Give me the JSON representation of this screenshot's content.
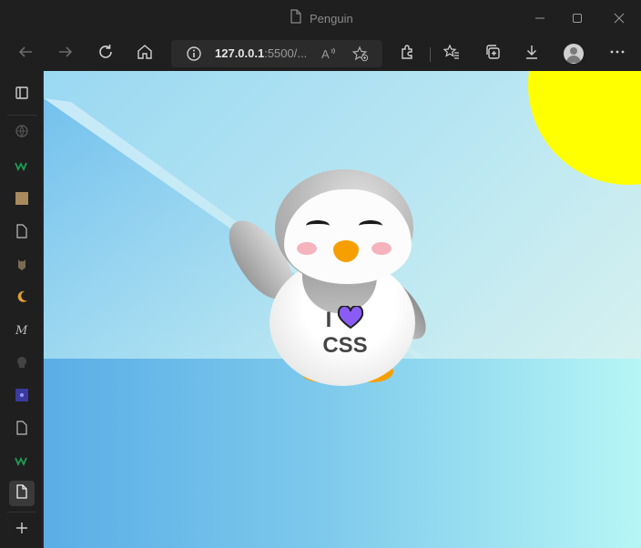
{
  "window": {
    "title": "Penguin",
    "controls": [
      "minimize-icon",
      "maximize-icon",
      "close-icon"
    ]
  },
  "toolbar": {
    "buttons": [
      "back-icon",
      "forward-icon",
      "refresh-icon",
      "home-icon"
    ],
    "address": {
      "host": "127.0.0.1",
      "rest": ":5500/...",
      "info_icon": "info-icon",
      "read_aloud_icon": "read-aloud-icon",
      "favorite_icon": "add-favorite-icon"
    },
    "right_buttons": [
      "extensions-icon",
      "favorites-icon",
      "collections-icon",
      "downloads-icon",
      "profile-avatar",
      "more-icon"
    ]
  },
  "sidebar": {
    "items": [
      "tab-actions-icon",
      "globe-icon",
      "w-icon",
      "image-icon",
      "page-icon",
      "owl-icon",
      "moon-icon",
      "m-icon",
      "skull-icon",
      "image2-icon",
      "page2-icon",
      "w2-icon",
      "page3-icon"
    ],
    "active_index": 12,
    "new_tab_icon": "plus-icon"
  },
  "scene": {
    "shirt_line1_letter": "I",
    "shirt_line2": "CSS",
    "colors": {
      "sun": "#ffff00",
      "beak_feet": "#f5a000",
      "cheeks": "#f5b3bd",
      "heart": "#8a5cf5",
      "sky_top": "#9ad8f2",
      "water_left": "#5aaee6",
      "water_right": "#b6f6f6"
    }
  }
}
